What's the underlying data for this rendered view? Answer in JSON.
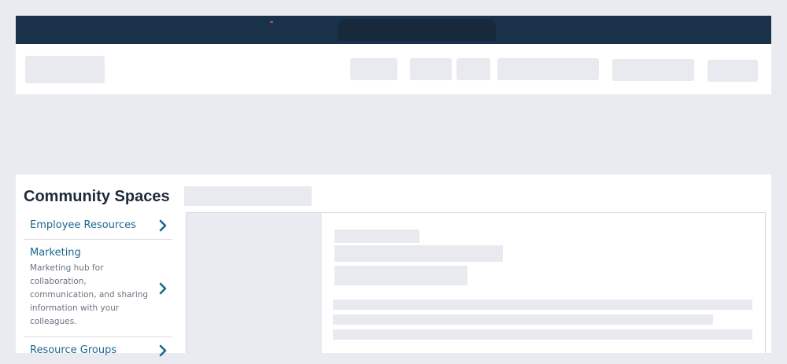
{
  "sidebar": {
    "heading": "Community Spaces",
    "items": [
      {
        "label": "Employee Resources",
        "description": ""
      },
      {
        "label": "Marketing",
        "description": "Marketing hub for collaboration, communication, and sharing information with your colleagues."
      },
      {
        "label": "Resource Groups",
        "description": ""
      }
    ]
  },
  "icons": {
    "chevron": "chevron-right-icon"
  },
  "colors": {
    "topbar": "#1a3249",
    "link": "#1c6890",
    "chevron": "#1c6890",
    "heading": "#1d2b3a"
  }
}
